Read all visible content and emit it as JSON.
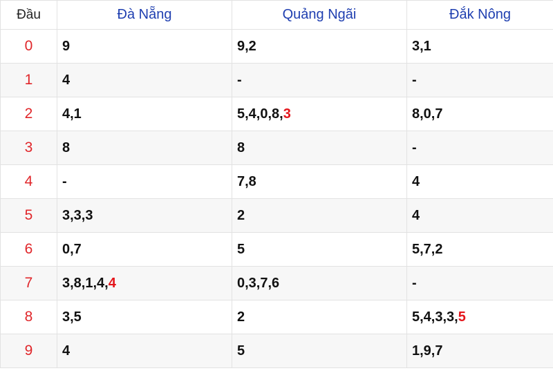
{
  "header": {
    "dau_label": "Đầu",
    "provinces": [
      "Đà Nẵng",
      "Quảng Ngãi",
      "Đắk Nông"
    ]
  },
  "colors": {
    "header_text": "#1f3fb0",
    "dau_text": "#e0262a",
    "highlight": "#e4151b",
    "row_alt": "#f7f7f7"
  },
  "rows": [
    {
      "dau": "0",
      "cells": [
        {
          "text": "9",
          "hl": ""
        },
        {
          "text": "9,2",
          "hl": ""
        },
        {
          "text": "3,1",
          "hl": ""
        }
      ]
    },
    {
      "dau": "1",
      "cells": [
        {
          "text": "4",
          "hl": ""
        },
        {
          "text": "-",
          "hl": ""
        },
        {
          "text": "-",
          "hl": ""
        }
      ]
    },
    {
      "dau": "2",
      "cells": [
        {
          "text": "4,1",
          "hl": ""
        },
        {
          "text": "5,4,0,8,",
          "hl": "3"
        },
        {
          "text": "8,0,7",
          "hl": ""
        }
      ]
    },
    {
      "dau": "3",
      "cells": [
        {
          "text": "8",
          "hl": ""
        },
        {
          "text": "8",
          "hl": ""
        },
        {
          "text": "-",
          "hl": ""
        }
      ]
    },
    {
      "dau": "4",
      "cells": [
        {
          "text": "-",
          "hl": ""
        },
        {
          "text": "7,8",
          "hl": ""
        },
        {
          "text": "4",
          "hl": ""
        }
      ]
    },
    {
      "dau": "5",
      "cells": [
        {
          "text": "3,3,3",
          "hl": ""
        },
        {
          "text": "2",
          "hl": ""
        },
        {
          "text": "4",
          "hl": ""
        }
      ]
    },
    {
      "dau": "6",
      "cells": [
        {
          "text": "0,7",
          "hl": ""
        },
        {
          "text": "5",
          "hl": ""
        },
        {
          "text": "5,7,2",
          "hl": ""
        }
      ]
    },
    {
      "dau": "7",
      "cells": [
        {
          "text": "3,8,1,4,",
          "hl": "4"
        },
        {
          "text": "0,3,7,6",
          "hl": ""
        },
        {
          "text": "-",
          "hl": ""
        }
      ]
    },
    {
      "dau": "8",
      "cells": [
        {
          "text": "3,5",
          "hl": ""
        },
        {
          "text": "2",
          "hl": ""
        },
        {
          "text": "5,4,3,3,",
          "hl": "5"
        }
      ]
    },
    {
      "dau": "9",
      "cells": [
        {
          "text": "4",
          "hl": ""
        },
        {
          "text": "5",
          "hl": ""
        },
        {
          "text": "1,9,7",
          "hl": ""
        }
      ]
    }
  ]
}
